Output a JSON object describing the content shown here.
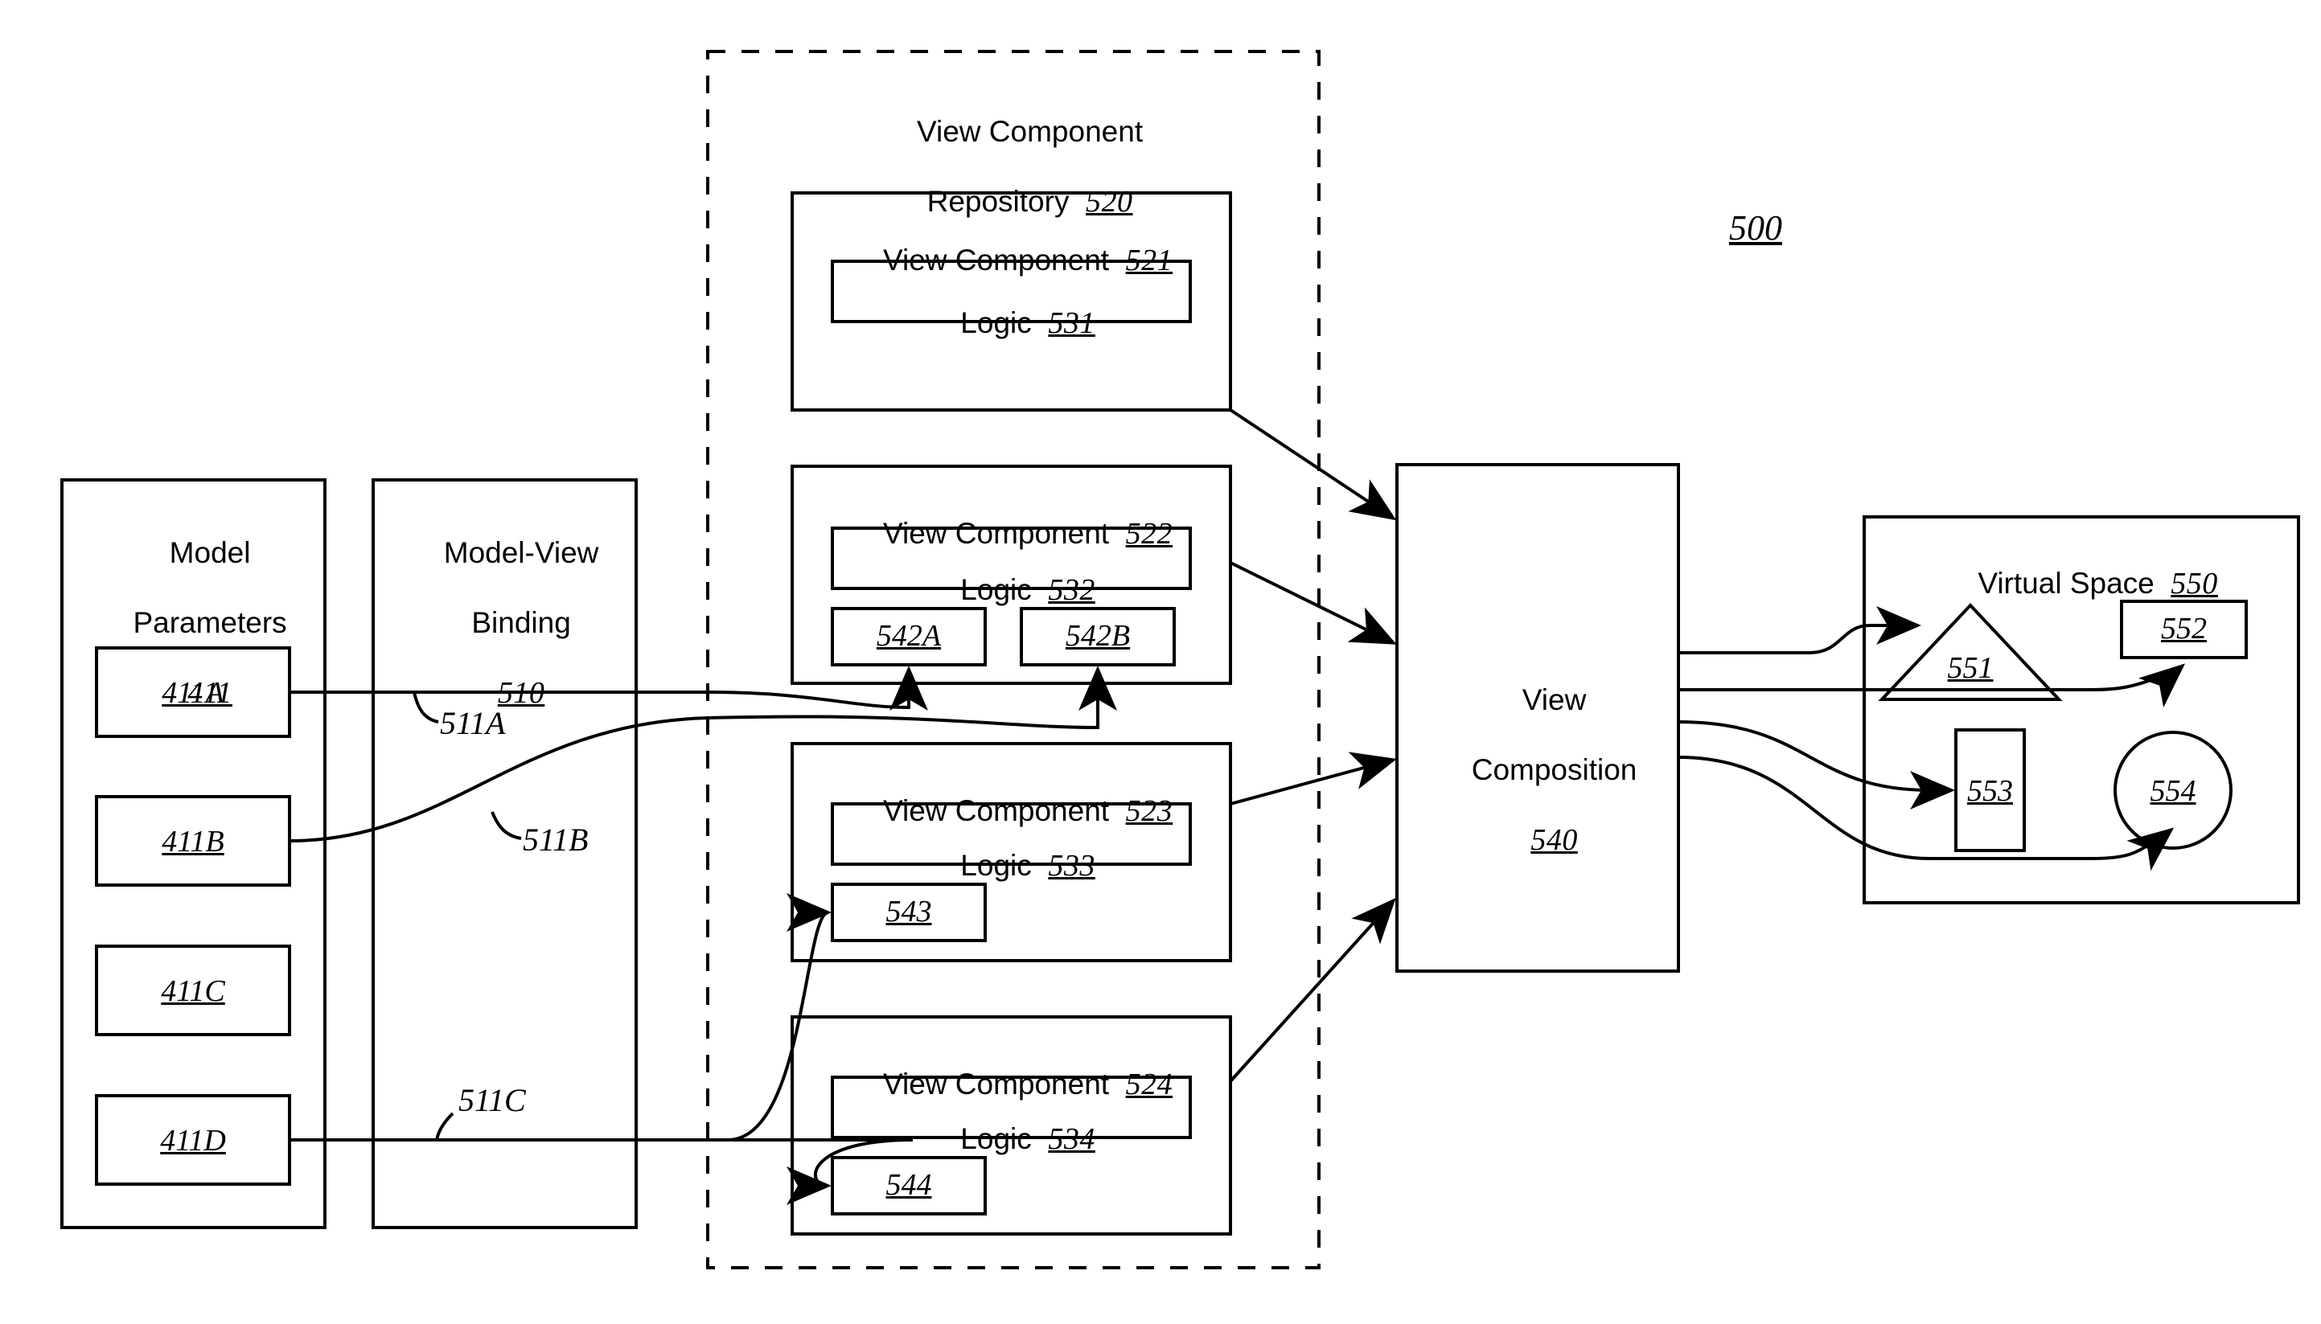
{
  "figure": {
    "number": "500"
  },
  "model_parameters": {
    "title_line1": "Model",
    "title_line2": "Parameters",
    "ref": "411",
    "items": [
      {
        "ref": "411A"
      },
      {
        "ref": "411B"
      },
      {
        "ref": "411C"
      },
      {
        "ref": "411D"
      }
    ]
  },
  "model_view_binding": {
    "title_line1": "Model-View",
    "title_line2": "Binding",
    "ref": "510",
    "bindings": [
      {
        "ref": "511A"
      },
      {
        "ref": "511B"
      },
      {
        "ref": "511C"
      }
    ]
  },
  "view_component_repository": {
    "title_line1": "View Component",
    "title_line2": "Repository",
    "ref": "520",
    "components": [
      {
        "title": "View Component",
        "ref": "521",
        "logic": {
          "title": "Logic",
          "ref": "531"
        },
        "sub_items": []
      },
      {
        "title": "View Component",
        "ref": "522",
        "logic": {
          "title": "Logic",
          "ref": "532"
        },
        "sub_items": [
          {
            "ref": "542A"
          },
          {
            "ref": "542B"
          }
        ]
      },
      {
        "title": "View Component",
        "ref": "523",
        "logic": {
          "title": "Logic",
          "ref": "533"
        },
        "sub_items": [
          {
            "ref": "543"
          }
        ]
      },
      {
        "title": "View Component",
        "ref": "524",
        "logic": {
          "title": "Logic",
          "ref": "534"
        },
        "sub_items": [
          {
            "ref": "544"
          }
        ]
      }
    ]
  },
  "view_composition": {
    "title_line1": "View",
    "title_line2": "Composition",
    "ref": "540"
  },
  "virtual_space": {
    "title": "Virtual Space",
    "ref": "550",
    "objects": [
      {
        "ref": "551",
        "shape": "triangle"
      },
      {
        "ref": "552",
        "shape": "rectangle"
      },
      {
        "ref": "553",
        "shape": "rectangle"
      },
      {
        "ref": "554",
        "shape": "circle"
      }
    ]
  },
  "colors": {
    "stroke": "#000000",
    "background": "#ffffff"
  }
}
